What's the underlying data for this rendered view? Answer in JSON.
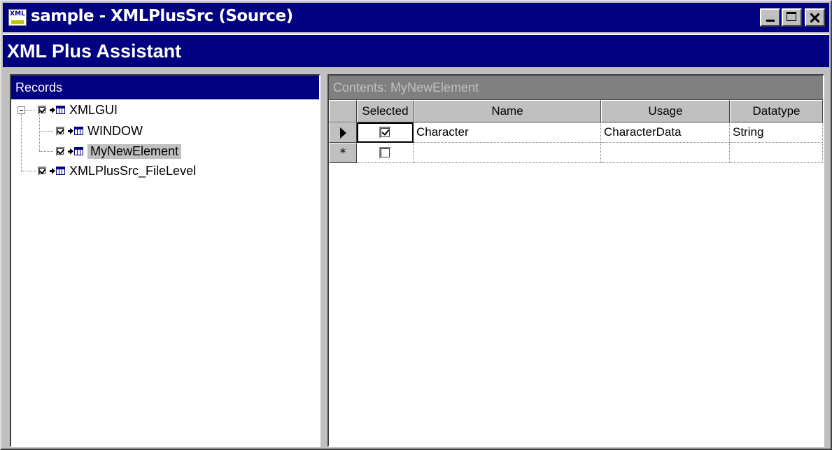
{
  "window": {
    "title": "sample - XMLPlusSrc (Source)",
    "app_icon_text": "XML",
    "controls": {
      "minimize": "minimize-icon",
      "maximize": "maximize-icon",
      "close": "close-icon"
    }
  },
  "header": {
    "title": "XML Plus Assistant"
  },
  "records": {
    "title": "Records",
    "items": [
      {
        "label": "XMLGUI",
        "checked": true,
        "expanded": true,
        "level": 0
      },
      {
        "label": "WINDOW",
        "checked": true,
        "level": 1
      },
      {
        "label": "MyNewElement",
        "checked": true,
        "level": 1,
        "selected": true
      },
      {
        "label": "XMLPlusSrc_FileLevel",
        "checked": true,
        "level": 0
      }
    ]
  },
  "contents": {
    "title": "Contents: MyNewElement",
    "columns": [
      "Selected",
      "Name",
      "Usage",
      "Datatype"
    ],
    "rows": [
      {
        "selected": true,
        "name": "Character",
        "usage": "CharacterData",
        "datatype": "String"
      }
    ],
    "new_row_marker": "*"
  },
  "colors": {
    "titlebar": "#000080",
    "face": "#c0c0c0",
    "inactive_caption": "#808080"
  }
}
